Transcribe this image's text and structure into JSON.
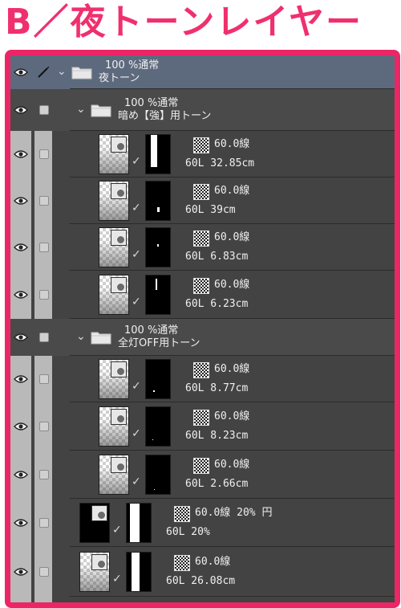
{
  "heading": "B／夜トーンレイヤー",
  "top_folder": {
    "mode": "100 %通常",
    "name": "夜トーン"
  },
  "folders": [
    {
      "mode": "100 %通常",
      "name": "暗め【強】用トーン"
    },
    {
      "mode": "100 %通常",
      "name": "全灯OFF用トーン"
    }
  ],
  "layers": [
    {
      "line1": "60.0線",
      "line2": "60L 32.85cm"
    },
    {
      "line1": "60.0線",
      "line2": "60L 39cm"
    },
    {
      "line1": "60.0線",
      "line2": "60L 6.83cm"
    },
    {
      "line1": "60.0線",
      "line2": "60L 6.23cm"
    },
    {
      "line1": "60.0線",
      "line2": "60L 8.77cm"
    },
    {
      "line1": "60.0線",
      "line2": "60L 8.23cm"
    },
    {
      "line1": "60.0線",
      "line2": "60L 2.66cm"
    },
    {
      "line1": "60.0線 20% 円",
      "line2": "60L 20%"
    },
    {
      "line1": "60.0線",
      "line2": "60L 26.08cm"
    }
  ],
  "icons": {
    "visibility": "eye-icon",
    "edit": "pencil-icon",
    "expand": "chevron-down-icon",
    "folder": "folder-icon",
    "tone": "halftone-pattern-icon",
    "mask": "layer-mask-thumbnail",
    "link": "check-mark-icon"
  },
  "colors": {
    "accent": "#ec2666",
    "panel": "#434343",
    "selected_row": "#5d6a7e"
  }
}
